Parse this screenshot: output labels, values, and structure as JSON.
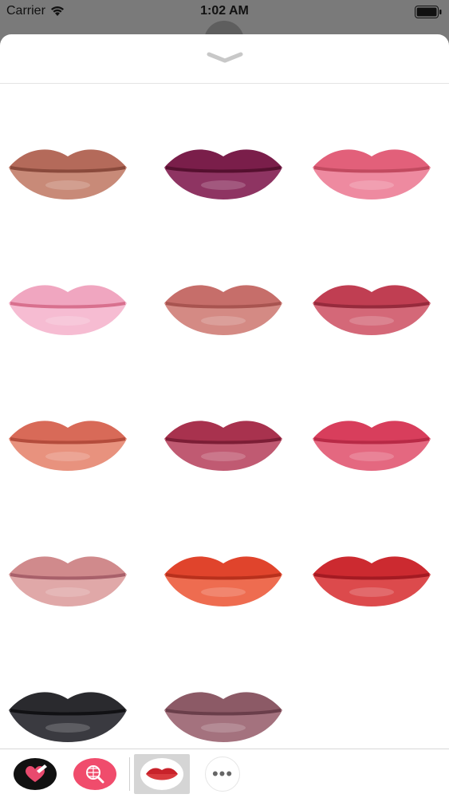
{
  "status_bar": {
    "carrier": "Carrier",
    "time": "1:02 AM",
    "wifi_icon": "wifi-icon",
    "battery_icon": "battery-icon"
  },
  "sheet": {
    "collapse_icon": "chevron-down-icon"
  },
  "stickers": [
    {
      "name": "lips-nude-brown",
      "upper": "#b46a5a",
      "lower": "#c88a78",
      "dark": "#8a4a3c"
    },
    {
      "name": "lips-plum",
      "upper": "#7a1e4a",
      "lower": "#8e3462",
      "dark": "#55102f"
    },
    {
      "name": "lips-pink",
      "upper": "#e2607a",
      "lower": "#ee8aa0",
      "dark": "#c24a60"
    },
    {
      "name": "lips-light-pink",
      "upper": "#f0a6c0",
      "lower": "#f6bcd2",
      "dark": "#d8708e"
    },
    {
      "name": "lips-rose-nude",
      "upper": "#c66e6a",
      "lower": "#d48a84",
      "dark": "#a85450"
    },
    {
      "name": "lips-raspberry",
      "upper": "#c03e52",
      "lower": "#d46878",
      "dark": "#962a3c"
    },
    {
      "name": "lips-coral",
      "upper": "#d86a58",
      "lower": "#e8927e",
      "dark": "#b44c3c"
    },
    {
      "name": "lips-berry",
      "upper": "#a8324e",
      "lower": "#c05a72",
      "dark": "#7c1e36"
    },
    {
      "name": "lips-crimson-pink",
      "upper": "#d83e5c",
      "lower": "#e46880",
      "dark": "#b82a46"
    },
    {
      "name": "lips-dusty-rose",
      "upper": "#d08a8c",
      "lower": "#e0a8a8",
      "dark": "#a8606a"
    },
    {
      "name": "lips-orange-red",
      "upper": "#e0442c",
      "lower": "#ee6c50",
      "dark": "#b8301c"
    },
    {
      "name": "lips-red",
      "upper": "#cc2a30",
      "lower": "#dc4a4c",
      "dark": "#a41a22"
    },
    {
      "name": "lips-black",
      "upper": "#2a2a2e",
      "lower": "#3a3a40",
      "dark": "#111114"
    },
    {
      "name": "lips-mauve",
      "upper": "#8c5a66",
      "lower": "#a4727e",
      "dark": "#6a3e4a"
    }
  ],
  "tray": {
    "items": [
      {
        "name": "heart-app-icon"
      },
      {
        "name": "globe-search-app-icon"
      },
      {
        "name": "lips-sticker-app-icon"
      },
      {
        "name": "more-apps-icon",
        "label": "•••"
      }
    ]
  }
}
